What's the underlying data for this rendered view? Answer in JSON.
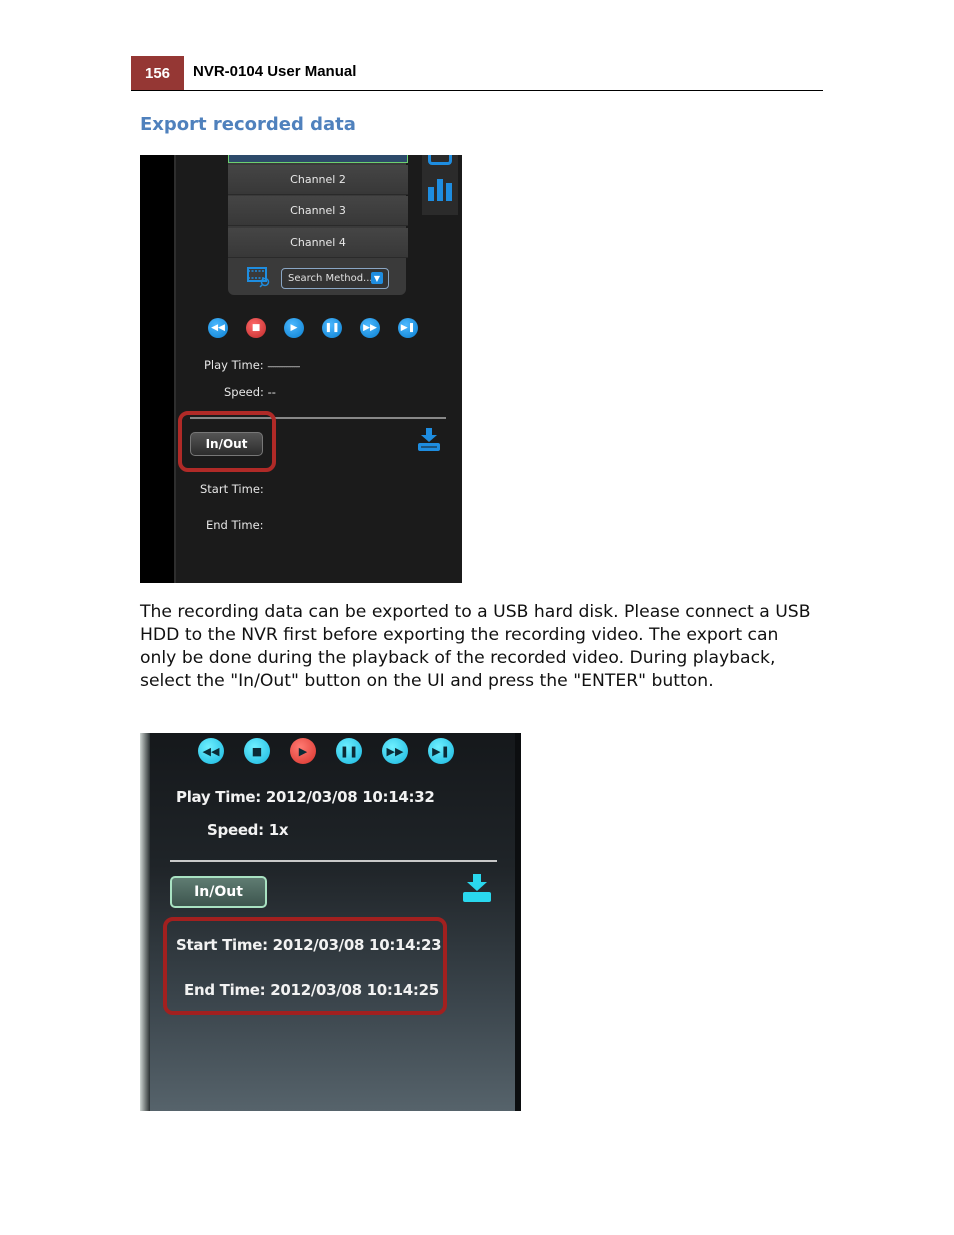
{
  "header": {
    "page_number": "156",
    "manual_title": "NVR-0104  User Manual"
  },
  "section": {
    "heading": "Export recorded data"
  },
  "screenshot1": {
    "channels": [
      "Channel 2",
      "Channel 3",
      "Channel 4"
    ],
    "search_method": {
      "value": "Search Method...",
      "dropdown_icon": "▼"
    },
    "controls": [
      {
        "name": "rewind",
        "glyph": "◀◀"
      },
      {
        "name": "stop",
        "glyph": "■"
      },
      {
        "name": "play",
        "glyph": "▶"
      },
      {
        "name": "pause",
        "glyph": "❚❚"
      },
      {
        "name": "fast-forward",
        "glyph": "▶▶"
      },
      {
        "name": "next-frame",
        "glyph": "▶❚"
      }
    ],
    "play_time_label": "Play Time:",
    "play_time_value": "-----------------",
    "speed_label": "Speed:",
    "speed_value": "--",
    "inout_label": "In/Out",
    "start_time_label": "Start Time:",
    "end_time_label": "End Time:",
    "highlight_color": "#b02a27",
    "accent_color": "#1e8de0"
  },
  "body": {
    "paragraph": "The recording data can be exported to a USB hard disk. Please connect a USB HDD to the NVR first before exporting the recording video. The export can only be done during the playback of the recorded video. During playback, select the \"In/Out\" button on the UI and press the \"ENTER\" button."
  },
  "screenshot2": {
    "controls": [
      {
        "name": "rewind",
        "glyph": "◀◀"
      },
      {
        "name": "stop",
        "glyph": "■"
      },
      {
        "name": "play",
        "glyph": "▶"
      },
      {
        "name": "pause",
        "glyph": "❚❚"
      },
      {
        "name": "fast-forward",
        "glyph": "▶▶"
      },
      {
        "name": "next-frame",
        "glyph": "▶❚"
      }
    ],
    "play_time": "Play Time: 2012/03/08 10:14:32",
    "speed": "Speed: 1x",
    "inout_label": "In/Out",
    "start_time": "Start Time: 2012/03/08 10:14:23",
    "end_time": "End Time: 2012/03/08 10:14:25",
    "highlight_color": "#a2201f",
    "accent_color": "#18b6df"
  }
}
